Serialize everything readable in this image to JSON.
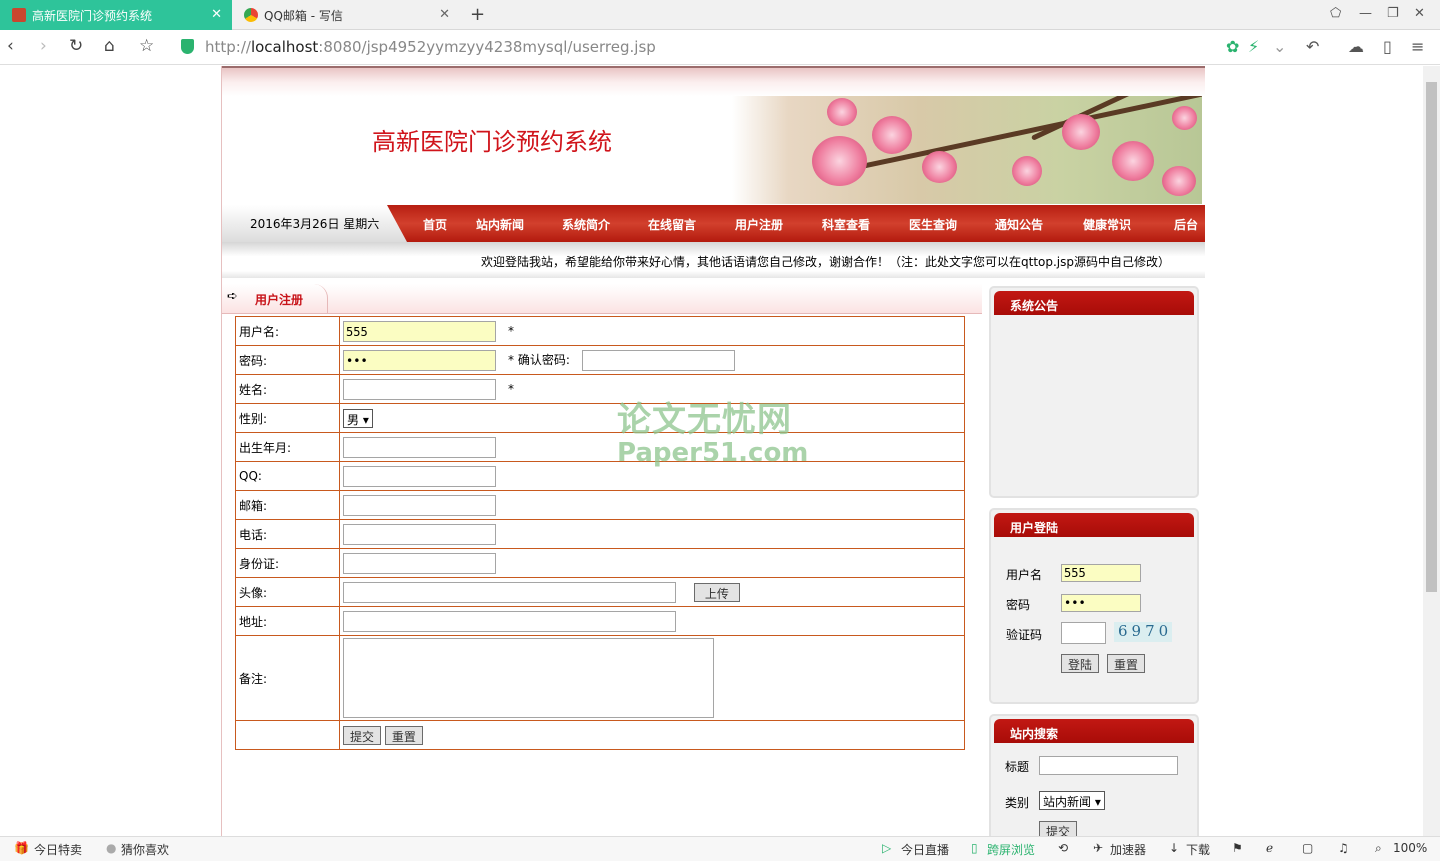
{
  "browser": {
    "tabs": [
      {
        "title": "高新医院门诊预约系统",
        "active": true
      },
      {
        "title": "QQ邮箱 - 写信",
        "active": false
      }
    ],
    "url_prefix": "http://",
    "url_host": "localhost",
    "url_rest": ":8080/jsp4952yymzyy4238mysql/userreg.jsp",
    "status": {
      "left1": "今日特卖",
      "left2": "猜你喜欢",
      "right1": "今日直播",
      "right2": "跨屏浏览",
      "right3": "加速器",
      "right4": "下载",
      "zoom": "100%"
    },
    "accent": "#2ec49a"
  },
  "site": {
    "title": "高新医院门诊预约系统",
    "date": "2016年3月26日 星期六",
    "nav": [
      "首页",
      "站内新闻",
      "系统简介",
      "在线留言",
      "用户注册",
      "科室查看",
      "医生查询",
      "通知公告",
      "健康常识",
      "后台"
    ],
    "marquee": "欢迎登陆我站，希望能给你带来好心情，其他话语请您自己修改，谢谢合作！（注：此处文字您可以在qttop.jsp源码中自己修改）"
  },
  "register": {
    "title": "用户注册",
    "labels": {
      "username": "用户名:",
      "password": "密码:",
      "confirm": "确认密码:",
      "name": "姓名:",
      "gender": "性别:",
      "birth": "出生年月:",
      "qq": "QQ:",
      "email": "邮箱:",
      "phone": "电话:",
      "idcard": "身份证:",
      "avatar": "头像:",
      "address": "地址:",
      "remark": "备注:"
    },
    "values": {
      "username": "555",
      "password": "•••",
      "gender": "男"
    },
    "required_mark": "*",
    "upload_button": "上传",
    "submit_button": "提交",
    "reset_button": "重置"
  },
  "sidebar": {
    "notice_title": "系统公告",
    "login": {
      "title": "用户登陆",
      "username_label": "用户名",
      "username_value": "555",
      "password_label": "密码",
      "password_value": "•••",
      "captcha_label": "验证码",
      "captcha_code": "6970",
      "login_button": "登陆",
      "reset_button": "重置"
    },
    "search": {
      "title": "站内搜索",
      "title_label": "标题",
      "category_label": "类别",
      "category_value": "站内新闻",
      "submit_button": "提交"
    }
  },
  "watermark": {
    "line1": "论文无忧网",
    "line2": "Paper51.com"
  }
}
